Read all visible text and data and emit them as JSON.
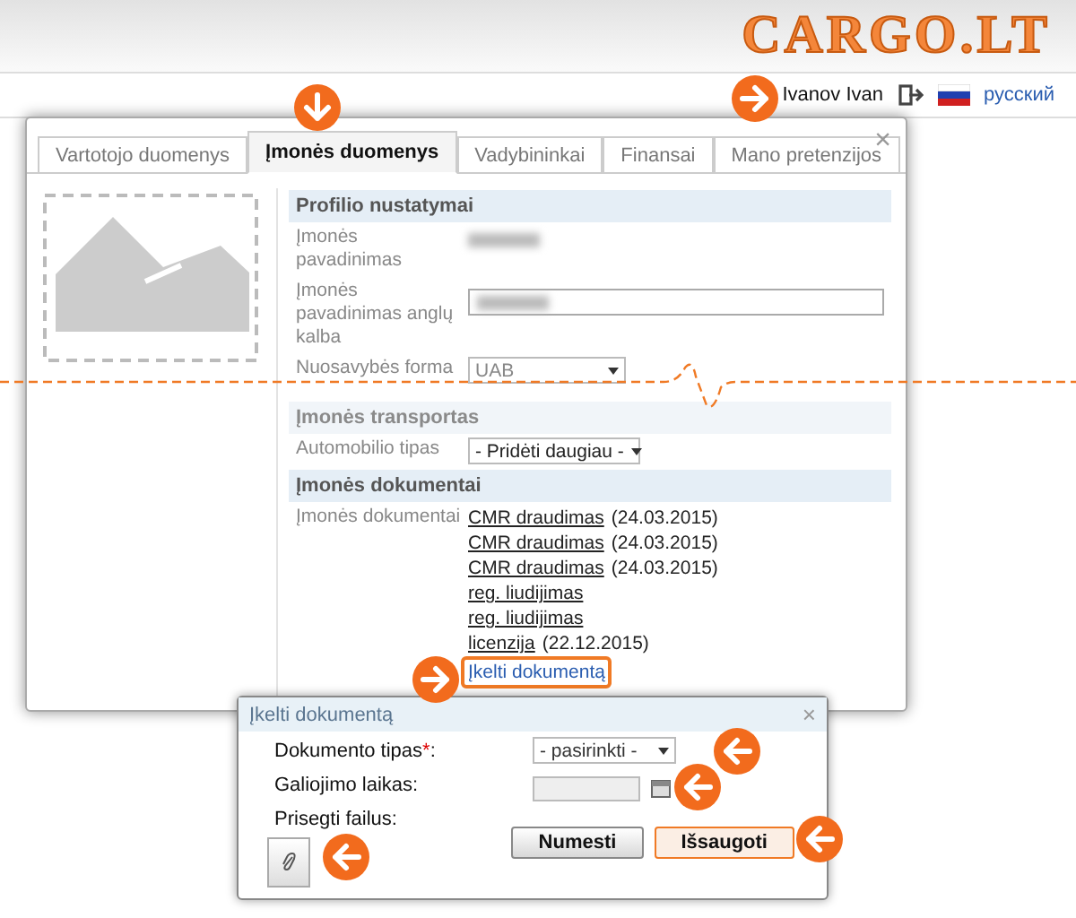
{
  "logo": "CARGO.LT",
  "user": {
    "name": "Ivanov Ivan",
    "language": "русский"
  },
  "tabs": [
    {
      "label": "Vartotojo duomenys",
      "selected": false
    },
    {
      "label": "Įmonės duomenys",
      "selected": true
    },
    {
      "label": "Vadybininkai",
      "selected": false
    },
    {
      "label": "Finansai",
      "selected": false
    },
    {
      "label": "Mano pretenzijos",
      "selected": false
    }
  ],
  "close": "×",
  "profile": {
    "title": "Profilio nustatymai",
    "fields": [
      {
        "kind": "text",
        "label": "Įmonės pavadinimas"
      },
      {
        "kind": "input",
        "label": "Įmonės pavadinimas anglų kalba"
      },
      {
        "kind": "select",
        "label": "Nuosavybės forma",
        "value": "UAB"
      }
    ]
  },
  "transport": {
    "title": "Įmonės transportas",
    "fields": [
      {
        "kind": "select",
        "label": "Automobilio tipas",
        "value": "- Pridėti daugiau -"
      }
    ]
  },
  "documents": {
    "title": "Įmonės dokumentai",
    "label": "Įmonės dokumentai",
    "items": [
      {
        "name": "CMR draudimas",
        "date": "(24.03.2015)"
      },
      {
        "name": "CMR draudimas",
        "date": "(24.03.2015)"
      },
      {
        "name": "CMR draudimas",
        "date": "(24.03.2015)"
      },
      {
        "name": "reg. liudijimas"
      },
      {
        "name": "reg. liudijimas"
      },
      {
        "name": "licenzija",
        "date": "(22.12.2015)"
      }
    ],
    "upload_link": "Įkelti dokumentą"
  },
  "dialog": {
    "title": "Įkelti dokumentą",
    "close": "×",
    "type_label": "Dokumento tipas",
    "required_mark": "*",
    "type_suffix": ":",
    "type_value": "- pasirinkti -",
    "date_label": "Galiojimo laikas:",
    "attach_label": "Prisegti failus:",
    "buttons": [
      {
        "label": "Numesti",
        "primary": false
      },
      {
        "label": "Išsaugoti",
        "primary": true
      }
    ]
  }
}
